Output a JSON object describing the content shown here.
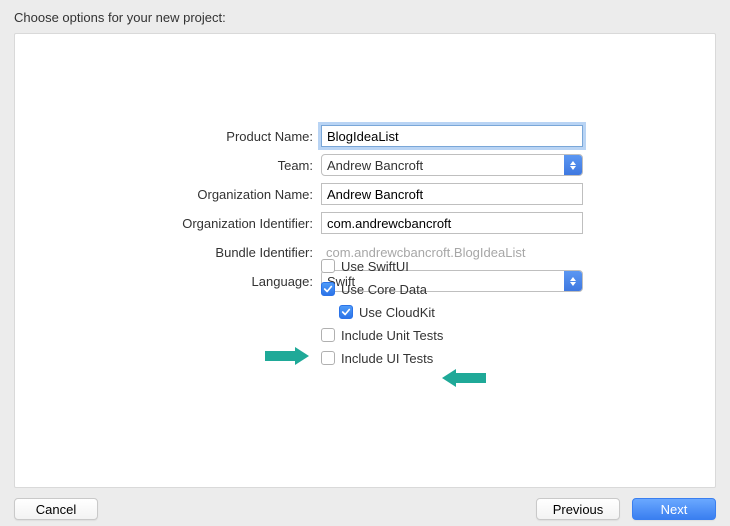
{
  "title": "Choose options for your new project:",
  "form": {
    "productName": {
      "label": "Product Name:",
      "value": "BlogIdeaList"
    },
    "team": {
      "label": "Team:",
      "value": "Andrew Bancroft"
    },
    "orgName": {
      "label": "Organization Name:",
      "value": "Andrew Bancroft"
    },
    "orgId": {
      "label": "Organization Identifier:",
      "value": "com.andrewcbancroft"
    },
    "bundleId": {
      "label": "Bundle Identifier:",
      "value": "com.andrewcbancroft.BlogIdeaList"
    },
    "language": {
      "label": "Language:",
      "value": "Swift"
    }
  },
  "checks": {
    "swiftui": {
      "label": "Use SwiftUI",
      "checked": false
    },
    "coredata": {
      "label": "Use Core Data",
      "checked": true
    },
    "cloudkit": {
      "label": "Use CloudKit",
      "checked": true
    },
    "unitTests": {
      "label": "Include Unit Tests",
      "checked": false
    },
    "uiTests": {
      "label": "Include UI Tests",
      "checked": false
    }
  },
  "buttons": {
    "cancel": "Cancel",
    "previous": "Previous",
    "next": "Next"
  }
}
